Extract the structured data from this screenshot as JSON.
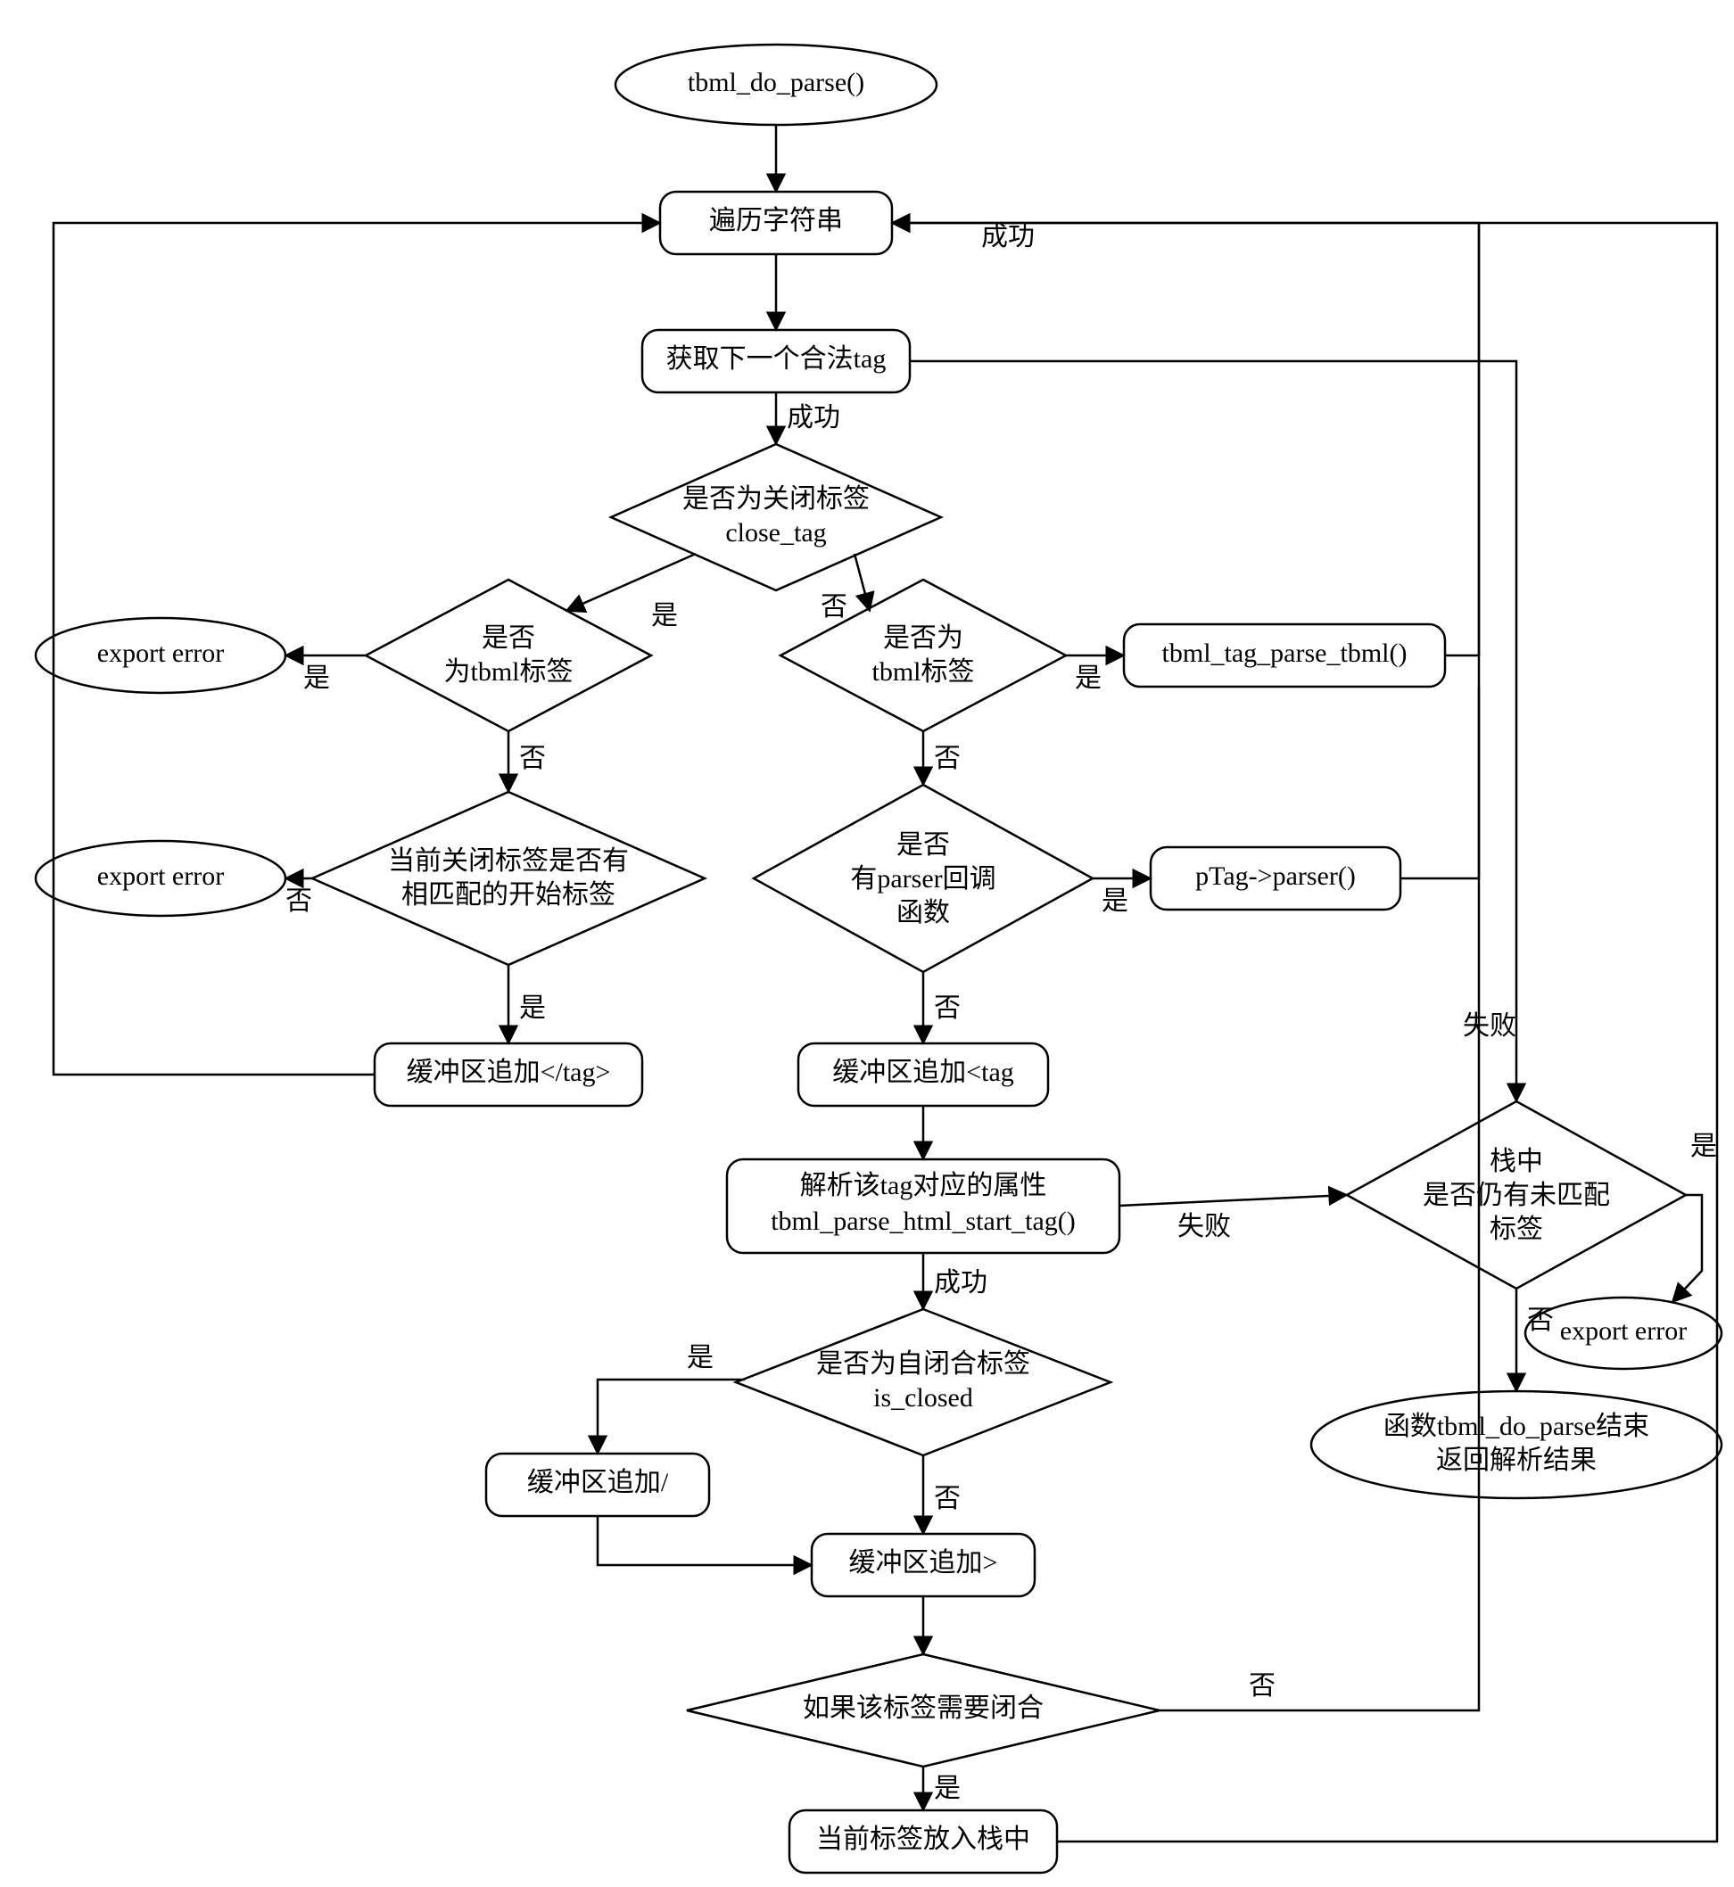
{
  "chart_data": {
    "type": "flowchart",
    "nodes": [
      {
        "id": "start",
        "shape": "ellipse",
        "label": "tbml_do_parse()"
      },
      {
        "id": "traverse",
        "shape": "roundrect",
        "label": "遍历字符串"
      },
      {
        "id": "getnext",
        "shape": "roundrect",
        "label": "获取下一个合法tag"
      },
      {
        "id": "isclose",
        "shape": "diamond2",
        "label": "是否为关闭标签\nclose_tag"
      },
      {
        "id": "isTbmlL",
        "shape": "diamond2",
        "label": "是否\n为tbml标签"
      },
      {
        "id": "isTbmlR",
        "shape": "diamond2",
        "label": "是否为\ntbml标签"
      },
      {
        "id": "errL1",
        "shape": "ellipse",
        "label": "export error"
      },
      {
        "id": "parseTbml",
        "shape": "roundrect",
        "label": "tbml_tag_parse_tbml()"
      },
      {
        "id": "hasMatch",
        "shape": "diamond3",
        "label": "当前关闭标签是否有\n相匹配的开始标签"
      },
      {
        "id": "hasParser",
        "shape": "diamond3",
        "label": "是否\n有parser回调\n函数"
      },
      {
        "id": "errL2",
        "shape": "ellipse",
        "label": "export error"
      },
      {
        "id": "ptagParser",
        "shape": "roundrect",
        "label": "pTag->parser()"
      },
      {
        "id": "appendClose",
        "shape": "roundrect",
        "label": "缓冲区追加</tag>"
      },
      {
        "id": "appendOpen",
        "shape": "roundrect",
        "label": "缓冲区追加<tag"
      },
      {
        "id": "parseAttr",
        "shape": "roundrect",
        "label": "解析该tag对应的属性\ntbml_parse_html_start_tag()"
      },
      {
        "id": "isSelfClose",
        "shape": "diamond2",
        "label": "是否为自闭合标签\nis_closed"
      },
      {
        "id": "appendSlash",
        "shape": "roundrect",
        "label": "缓冲区追加/"
      },
      {
        "id": "appendGt",
        "shape": "roundrect",
        "label": "缓冲区追加>"
      },
      {
        "id": "needClose",
        "shape": "diamond1",
        "label": "如果该标签需要闭合"
      },
      {
        "id": "pushStack",
        "shape": "roundrect",
        "label": "当前标签放入栈中"
      },
      {
        "id": "stackLeft",
        "shape": "diamond3",
        "label": "栈中\n是否仍有未匹配\n标签"
      },
      {
        "id": "errR",
        "shape": "ellipse",
        "label": "export error"
      },
      {
        "id": "end",
        "shape": "ellipse2",
        "label": "函数tbml_do_parse结束\n返回解析结果"
      }
    ],
    "edges": [
      {
        "from": "start",
        "to": "traverse"
      },
      {
        "from": "traverse",
        "to": "getnext"
      },
      {
        "from": "getnext",
        "to": "isclose",
        "label": "成功"
      },
      {
        "from": "isclose",
        "to": "isTbmlL",
        "label": "是"
      },
      {
        "from": "isclose",
        "to": "isTbmlR",
        "label": "否"
      },
      {
        "from": "isTbmlL",
        "to": "errL1",
        "label": "是"
      },
      {
        "from": "isTbmlL",
        "to": "hasMatch",
        "label": "否"
      },
      {
        "from": "isTbmlR",
        "to": "parseTbml",
        "label": "是"
      },
      {
        "from": "isTbmlR",
        "to": "hasParser",
        "label": "否"
      },
      {
        "from": "hasMatch",
        "to": "errL2",
        "label": "否"
      },
      {
        "from": "hasMatch",
        "to": "appendClose",
        "label": "是"
      },
      {
        "from": "hasParser",
        "to": "ptagParser",
        "label": "是"
      },
      {
        "from": "hasParser",
        "to": "appendOpen",
        "label": "否"
      },
      {
        "from": "appendOpen",
        "to": "parseAttr"
      },
      {
        "from": "parseAttr",
        "to": "isSelfClose",
        "label": "成功"
      },
      {
        "from": "isSelfClose",
        "to": "appendSlash",
        "label": "是"
      },
      {
        "from": "isSelfClose",
        "to": "appendGt",
        "label": "否"
      },
      {
        "from": "appendSlash",
        "to": "appendGt"
      },
      {
        "from": "appendGt",
        "to": "needClose"
      },
      {
        "from": "needClose",
        "to": "pushStack",
        "label": "是"
      },
      {
        "from": "needClose",
        "to": "traverse",
        "label": "否",
        "route": "right-loop"
      },
      {
        "from": "pushStack",
        "to": "traverse",
        "route": "right-loop"
      },
      {
        "from": "appendClose",
        "to": "traverse",
        "route": "left-loop"
      },
      {
        "from": "parseTbml",
        "to": "traverse",
        "label": "成功",
        "route": "right-loop"
      },
      {
        "from": "ptagParser",
        "to": "traverse",
        "route": "right-loop"
      },
      {
        "from": "getnext",
        "to": "stackLeft",
        "label": "失败",
        "route": "right"
      },
      {
        "from": "parseAttr",
        "to": "stackLeft",
        "label": "失败",
        "route": "right"
      },
      {
        "from": "stackLeft",
        "to": "errR",
        "label": "是"
      },
      {
        "from": "stackLeft",
        "to": "end",
        "label": "否"
      }
    ]
  },
  "labels": {
    "success": "成功",
    "fail": "失败",
    "yes": "是",
    "no": "否"
  }
}
